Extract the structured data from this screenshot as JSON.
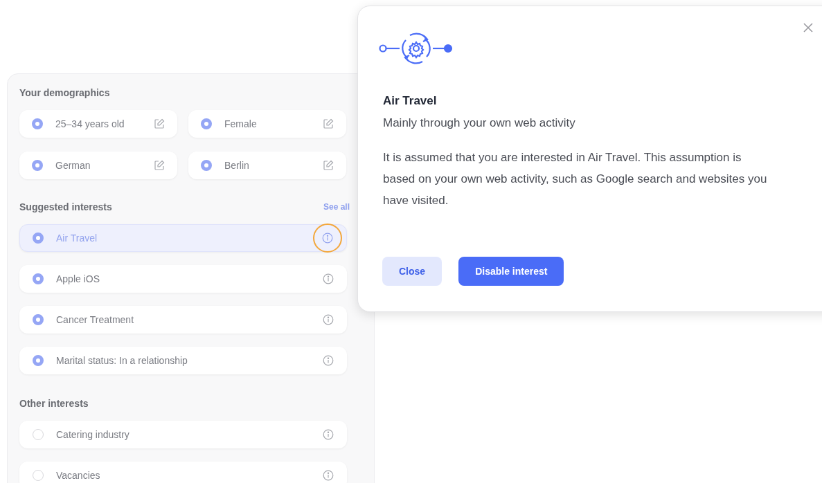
{
  "demographics": {
    "title": "Your demographics",
    "items": [
      {
        "label": "25–34 years old",
        "checked": true
      },
      {
        "label": "Female",
        "checked": true
      },
      {
        "label": "German",
        "checked": true
      },
      {
        "label": "Berlin",
        "checked": true
      }
    ]
  },
  "suggested": {
    "title": "Suggested interests",
    "link": "See all",
    "items": [
      {
        "label": "Air Travel",
        "checked": true,
        "selected": true
      },
      {
        "label": "Apple iOS",
        "checked": true,
        "selected": false
      },
      {
        "label": "Cancer Treatment",
        "checked": true,
        "selected": false
      },
      {
        "label": "Marital status: In a relationship",
        "checked": true,
        "selected": false
      }
    ]
  },
  "other": {
    "title": "Other interests",
    "items": [
      {
        "label": "Catering industry",
        "checked": false,
        "selected": false
      },
      {
        "label": "Vacancies",
        "checked": false,
        "selected": false
      }
    ]
  },
  "dialog": {
    "title": "Air Travel",
    "subtitle": "Mainly through your own web activity",
    "body": "It is assumed that you are interested in Air Travel. This assumption is based on your own web activity, such as Google search and websites you have visited.",
    "buttons": [
      {
        "label": "Close",
        "kind": "secondary"
      },
      {
        "label": "Disable interest",
        "kind": "primary"
      }
    ]
  }
}
